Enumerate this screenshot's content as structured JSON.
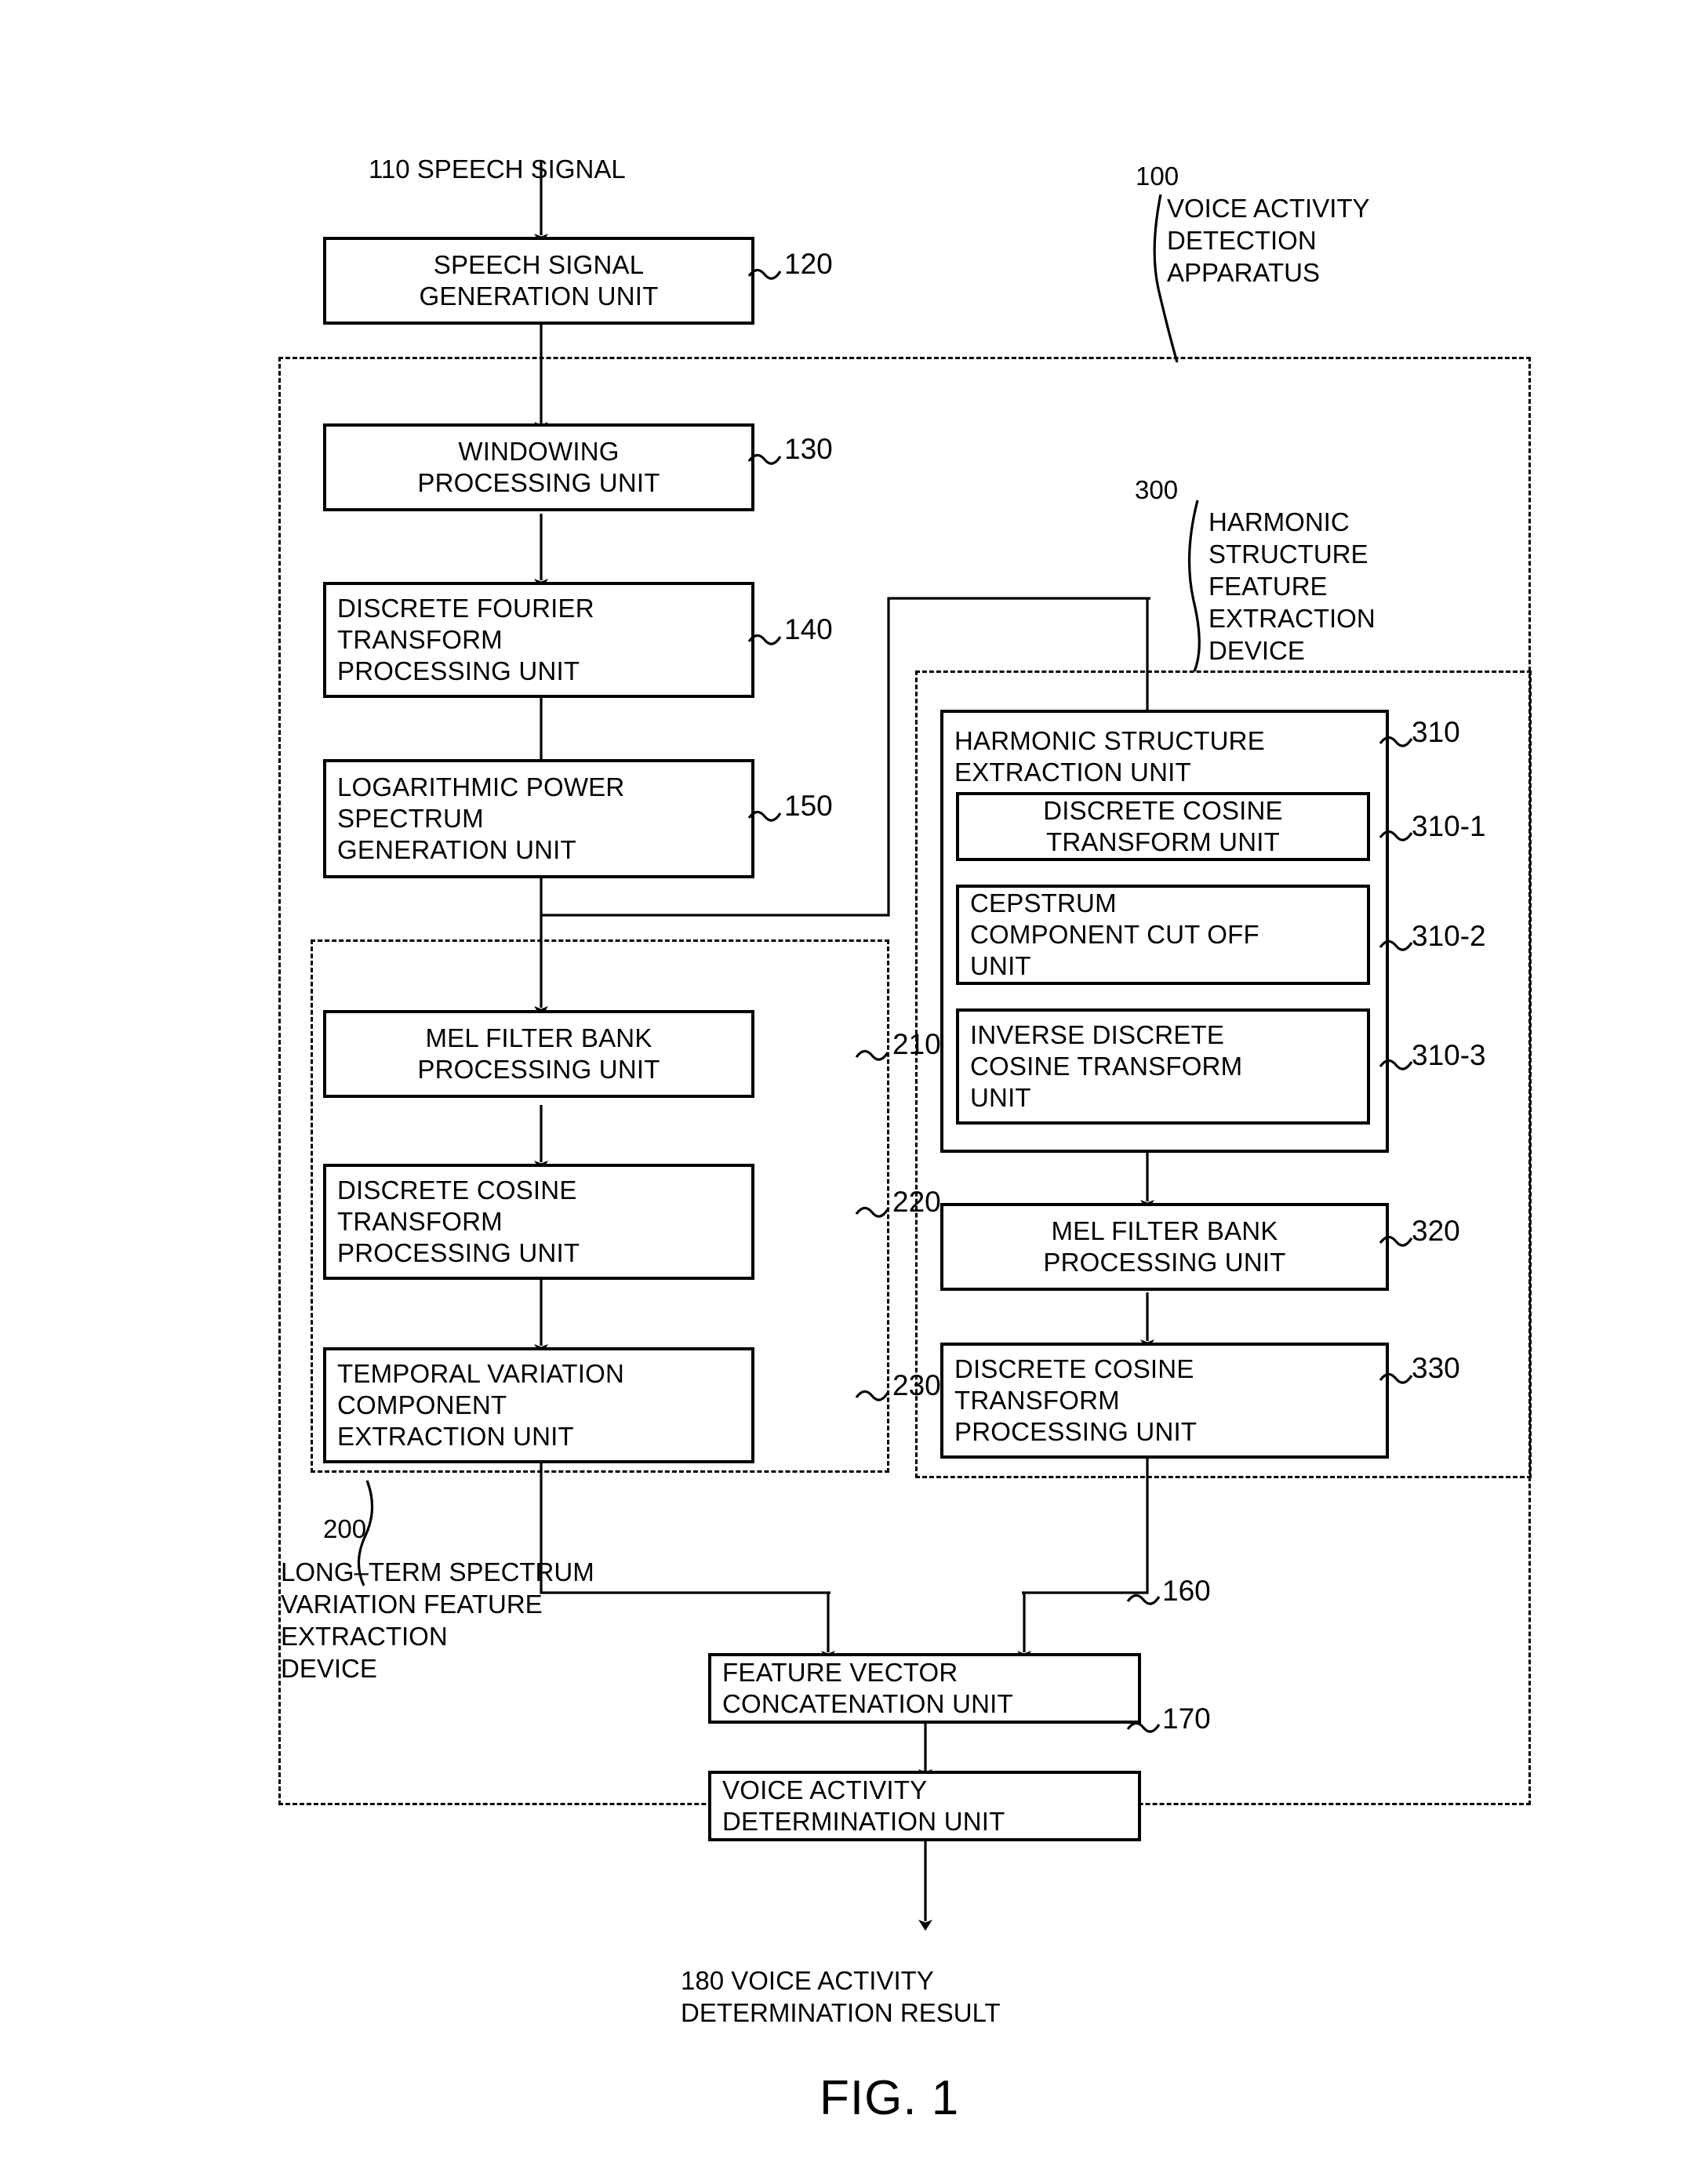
{
  "figure": {
    "caption": "FIG. 1",
    "input_label": {
      "ref": "110",
      "text": "SPEECH SIGNAL"
    },
    "output_label": {
      "ref": "180",
      "text": "VOICE ACTIVITY\nDETERMINATION RESULT"
    }
  },
  "containers": [
    {
      "id": "apparatus",
      "ref": "100",
      "text": "VOICE ACTIVITY\nDETECTION\nAPPARATUS"
    },
    {
      "id": "harmonic_device",
      "ref": "300",
      "text": "HARMONIC\nSTRUCTURE\nFEATURE\nEXTRACTION\nDEVICE"
    },
    {
      "id": "longterm_device",
      "ref": "200",
      "text": "LONG–TERM SPECTRUM\nVARIATION FEATURE\nEXTRACTION\nDEVICE"
    }
  ],
  "blocks": [
    {
      "id": "b120",
      "ref": "120",
      "text": "SPEECH SIGNAL\nGENERATION UNIT"
    },
    {
      "id": "b130",
      "ref": "130",
      "text": "WINDOWING\nPROCESSING UNIT"
    },
    {
      "id": "b140",
      "ref": "140",
      "text": "DISCRETE FOURIER\nTRANSFORM\nPROCESSING UNIT"
    },
    {
      "id": "b150",
      "ref": "150",
      "text": "LOGARITHMIC POWER\nSPECTRUM\nGENERATION UNIT"
    },
    {
      "id": "b210",
      "ref": "210",
      "text": "MEL FILTER BANK\nPROCESSING UNIT"
    },
    {
      "id": "b220",
      "ref": "220",
      "text": "DISCRETE COSINE\nTRANSFORM\nPROCESSING UNIT"
    },
    {
      "id": "b230",
      "ref": "230",
      "text": "TEMPORAL VARIATION\nCOMPONENT\nEXTRACTION UNIT"
    },
    {
      "id": "b310",
      "ref": "310",
      "text": "HARMONIC STRUCTURE\nEXTRACTION UNIT"
    },
    {
      "id": "b310_1",
      "ref": "310-1",
      "text": "DISCRETE COSINE\nTRANSFORM UNIT"
    },
    {
      "id": "b310_2",
      "ref": "310-2",
      "text": "CEPSTRUM\nCOMPONENT CUT OFF\nUNIT"
    },
    {
      "id": "b310_3",
      "ref": "310-3",
      "text": "INVERSE DISCRETE\nCOSINE TRANSFORM\nUNIT"
    },
    {
      "id": "b320",
      "ref": "320",
      "text": "MEL FILTER BANK\nPROCESSING UNIT"
    },
    {
      "id": "b330",
      "ref": "330",
      "text": "DISCRETE COSINE\nTRANSFORM\nPROCESSING UNIT"
    },
    {
      "id": "b160",
      "ref": "160",
      "text": "FEATURE VECTOR\nCONCATENATION UNIT"
    },
    {
      "id": "b170",
      "ref": "170",
      "text": "VOICE ACTIVITY\nDETERMINATION UNIT"
    }
  ],
  "colors": {
    "ink": "#000000",
    "paper": "#ffffff"
  }
}
